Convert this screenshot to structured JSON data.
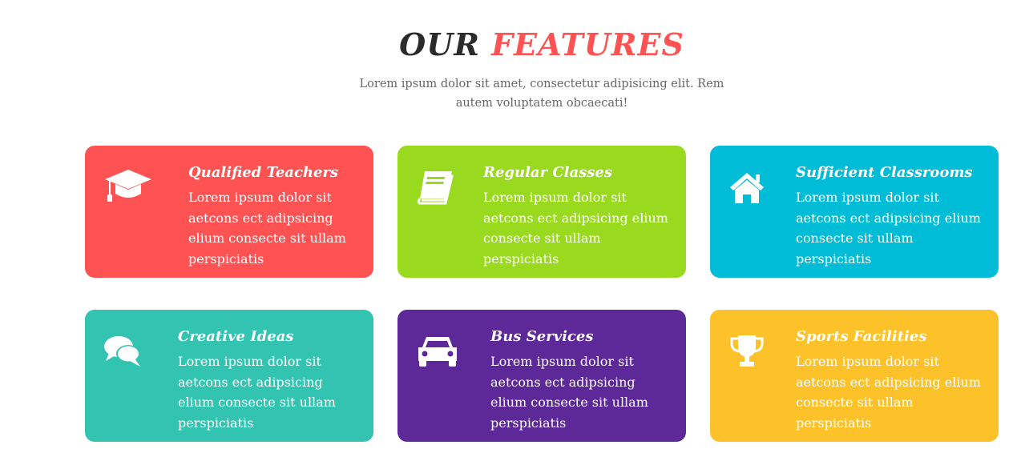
{
  "header": {
    "title_part1": "OUR",
    "title_part2": "FEATURES",
    "subtitle": "Lorem ipsum dolor sit amet, consectetur adipisicing elit. Rem autem voluptatem obcaecati!"
  },
  "colors": {
    "title_dark": "#2b2b2b",
    "title_accent": "#ff5252",
    "subtitle_text": "#666666",
    "card_red": "#ff5252",
    "card_green": "#99da1e",
    "card_blue": "#00bcd6",
    "card_teal": "#33c4b1",
    "card_purple": "#5d2898",
    "card_yellow": "#fdc12a"
  },
  "features": [
    {
      "title": "Qualified Teachers",
      "description": "Lorem ipsum dolor sit aetcons ect adipsicing elium consecte sit ullam perspiciatis",
      "icon": "graduation-cap-icon",
      "color": "#ff5252"
    },
    {
      "title": "Regular Classes",
      "description": "Lorem ipsum dolor sit aetcons ect adipsicing elium consecte sit ullam perspiciatis",
      "icon": "book-icon",
      "color": "#99da1e"
    },
    {
      "title": "Sufficient Classrooms",
      "description": "Lorem ipsum dolor sit aetcons ect adipsicing elium consecte sit ullam perspiciatis",
      "icon": "home-icon",
      "color": "#00bcd6"
    },
    {
      "title": "Creative Ideas",
      "description": "Lorem ipsum dolor sit aetcons ect adipsicing elium consecte sit ullam perspiciatis",
      "icon": "comments-icon",
      "color": "#33c4b1"
    },
    {
      "title": "Bus Services",
      "description": "Lorem ipsum dolor sit aetcons ect adipsicing elium consecte sit ullam perspiciatis",
      "icon": "car-icon",
      "color": "#5d2898"
    },
    {
      "title": "Sports Facilities",
      "description": "Lorem ipsum dolor sit aetcons ect adipsicing elium consecte sit ullam perspiciatis",
      "icon": "trophy-icon",
      "color": "#fdc12a"
    }
  ]
}
